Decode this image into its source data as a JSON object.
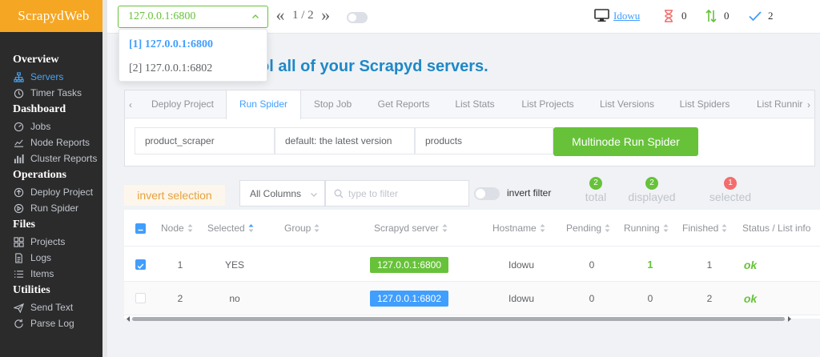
{
  "app": {
    "title": "ScrapydWeb"
  },
  "sidebar": {
    "sections": [
      {
        "title": "Overview",
        "items": [
          {
            "label": "Servers",
            "icon": "sitemap-icon",
            "active": true
          },
          {
            "label": "Timer Tasks",
            "icon": "timer-icon"
          }
        ]
      },
      {
        "title": "Dashboard",
        "items": [
          {
            "label": "Jobs",
            "icon": "gauge-icon"
          },
          {
            "label": "Node Reports",
            "icon": "chart-line-icon"
          },
          {
            "label": "Cluster Reports",
            "icon": "chart-bar-icon"
          }
        ]
      },
      {
        "title": "Operations",
        "items": [
          {
            "label": "Deploy Project",
            "icon": "upload-icon"
          },
          {
            "label": "Run Spider",
            "icon": "play-icon"
          }
        ]
      },
      {
        "title": "Files",
        "items": [
          {
            "label": "Projects",
            "icon": "grid-icon"
          },
          {
            "label": "Logs",
            "icon": "document-icon"
          },
          {
            "label": "Items",
            "icon": "list-icon"
          }
        ]
      },
      {
        "title": "Utilities",
        "items": [
          {
            "label": "Send Text",
            "icon": "send-icon"
          },
          {
            "label": "Parse Log",
            "icon": "refresh-icon"
          }
        ]
      }
    ]
  },
  "topbar": {
    "server_selected": "127.0.0.1:6800",
    "page_prev": "«",
    "page_next": "»",
    "page_indicator": "1 / 2",
    "user": "Idowu",
    "pending_count": "0",
    "running_count": "0",
    "finished_count": "2"
  },
  "dropdown": {
    "options": [
      {
        "label": "[1] 127.0.0.1:6800",
        "selected": true
      },
      {
        "label": "[2] 127.0.0.1:6802",
        "selected": false
      }
    ]
  },
  "headline": "ol all of your Scrapyd servers.",
  "tabs": {
    "items": [
      "Deploy Project",
      "Run Spider",
      "Stop Job",
      "Get Reports",
      "List Stats",
      "List Projects",
      "List Versions",
      "List Spiders",
      "List Runnir"
    ],
    "active_index": 1
  },
  "form": {
    "project": "product_scraper",
    "version": "default: the latest version",
    "spider": "products",
    "run_button": "Multinode Run Spider"
  },
  "filter": {
    "invert_selection": "invert selection",
    "columns_select": "All Columns",
    "placeholder": "type to filter",
    "invert_filter": "invert filter",
    "total_label": "total",
    "total_count": "2",
    "displayed_label": "displayed",
    "displayed_count": "2",
    "selected_label": "selected",
    "selected_count": "1"
  },
  "table": {
    "headers": {
      "node": "Node",
      "selected": "Selected",
      "group": "Group",
      "server": "Scrapyd server",
      "hostname": "Hostname",
      "pending": "Pending",
      "running": "Running",
      "finished": "Finished",
      "status": "Status / List info"
    },
    "rows": [
      {
        "checked": true,
        "node": "1",
        "selected": "YES",
        "group": "",
        "server": "127.0.0.1:6800",
        "server_color": "#67c23a",
        "hostname": "Idowu",
        "pending": "0",
        "running": "1",
        "finished": "1",
        "status": "ok"
      },
      {
        "checked": false,
        "node": "2",
        "selected": "no",
        "group": "",
        "server": "127.0.0.1:6802",
        "server_color": "#409eff",
        "hostname": "Idowu",
        "pending": "0",
        "running": "0",
        "finished": "2",
        "status": "ok"
      }
    ]
  },
  "colors": {
    "accent": "#409eff",
    "success": "#67c23a",
    "warning": "#e6a23c",
    "danger": "#f56c6c",
    "brand": "#f5a623"
  }
}
